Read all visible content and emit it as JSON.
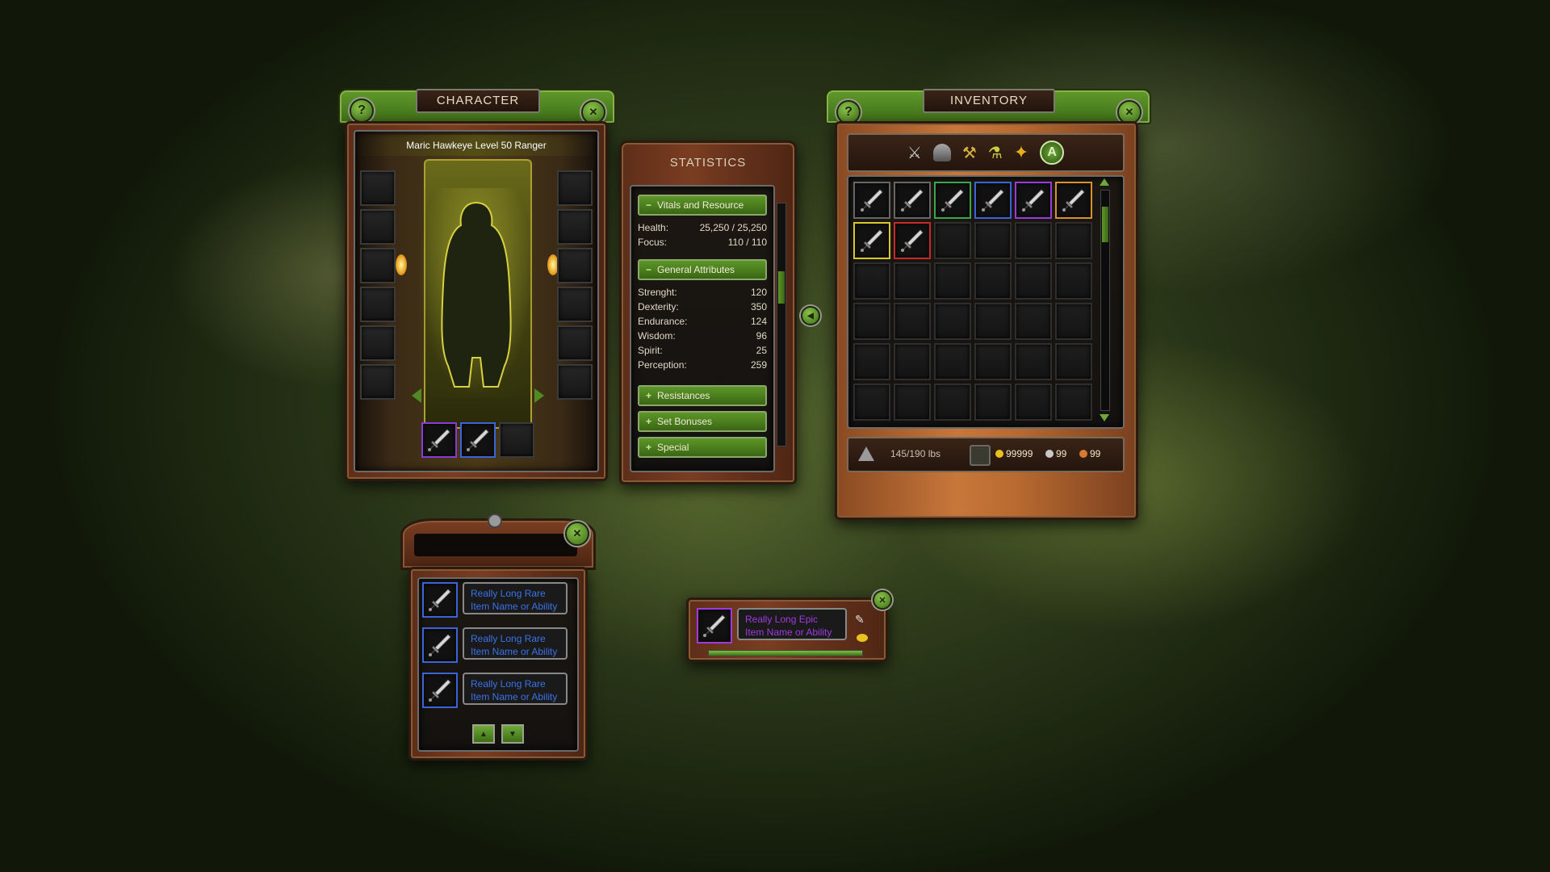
{
  "character": {
    "title": "CHARACTER",
    "help_label": "?",
    "close_label": "✕",
    "name_line": "Maric Hawkeye Level 50 Ranger",
    "equipped": [
      "purple",
      "blue",
      "empty"
    ],
    "colors": {
      "purple": "#8a3ad8",
      "blue": "#3a64d8"
    }
  },
  "statistics": {
    "title": "STATISTICS",
    "sections": {
      "vitals": {
        "label": "Vitals and Resource",
        "sign": "−"
      },
      "general": {
        "label": "General Attributes",
        "sign": "−"
      },
      "resistances": {
        "label": "Resistances",
        "sign": "+"
      },
      "set_bonuses": {
        "label": "Set Bonuses",
        "sign": "+"
      },
      "special": {
        "label": "Special",
        "sign": "+"
      }
    },
    "vitals": [
      {
        "label": "Health:",
        "value": "25,250 / 25,250"
      },
      {
        "label": "Focus:",
        "value": "110 / 110"
      }
    ],
    "attributes": [
      {
        "label": "Strenght:",
        "value": "120"
      },
      {
        "label": "Dexterity:",
        "value": "350"
      },
      {
        "label": "Endurance:",
        "value": "124"
      },
      {
        "label": "Wisdom:",
        "value": "96"
      },
      {
        "label": "Spirit:",
        "value": "25"
      },
      {
        "label": "Perception:",
        "value": "259"
      }
    ]
  },
  "inventory": {
    "title": "INVENTORY",
    "help_label": "?",
    "close_label": "✕",
    "filter_icons": [
      "weapons-icon",
      "helmet-icon",
      "crafting-icon",
      "potion-icon",
      "star-icon",
      "all-icon"
    ],
    "all_label": "A",
    "weight": "145/190 lbs",
    "gold": "99999",
    "silver": "99",
    "copper": "99",
    "items": [
      "black",
      "black",
      "green",
      "blue",
      "purple",
      "orange",
      "yellow",
      "red"
    ],
    "rarity_colors": {
      "black": "#666666",
      "green": "#3aa84a",
      "blue": "#3a64d8",
      "purple": "#9a3ad8",
      "orange": "#d8922a",
      "yellow": "#d8c82a",
      "red": "#c82a2a"
    }
  },
  "loot_chest": {
    "close_label": "✕",
    "items": [
      {
        "name_line1": "Really Long Rare",
        "name_line2": "Item Name or Ability"
      },
      {
        "name_line1": "Really Long Rare",
        "name_line2": "Item Name or Ability"
      },
      {
        "name_line1": "Really Long Rare",
        "name_line2": "Item Name or Ability"
      }
    ],
    "rare_color": "#3a72e8"
  },
  "loot_popup": {
    "close_label": "✕",
    "name_line1": "Really Long Epic",
    "name_line2": "Item Name or Ability",
    "epic_color": "#a03ae0"
  }
}
